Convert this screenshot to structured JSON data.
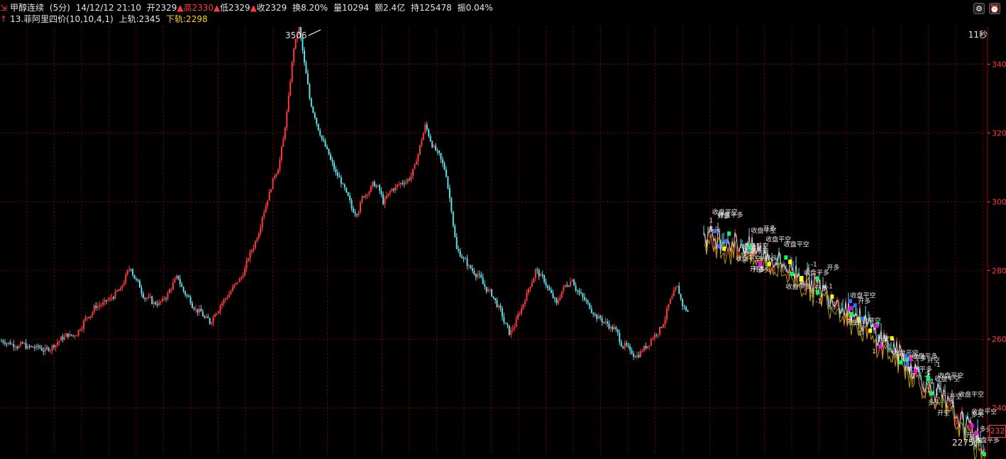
{
  "header": {
    "symbol_label": "甲醇连续",
    "period_label": "(5分)",
    "datetime": "14/12/12 21:10",
    "open": "开2329",
    "high": "高2330",
    "low": "低2329",
    "close": "收2329",
    "turnover": "换8.20%",
    "volume": "量10294",
    "amount": "额2.4亿",
    "position": "持125478",
    "amplitude": "振0.04%",
    "indicator_name": "13.菲阿里四价(10,10,4,1)",
    "upper_rail": "上轨:2345",
    "lower_rail": "下轨:2298",
    "colors": {
      "up": "#ff3b3b",
      "down": "#5fdfe8",
      "grid": "#7a0000",
      "text": "#e6e6e6",
      "yellow": "#ffd400"
    },
    "icons": [
      "gear-icon",
      "alarm-icon"
    ]
  },
  "countdown_label": "11秒",
  "current_price_label": "232",
  "chart_data": {
    "type": "candlestick",
    "y_axis": {
      "ticks": [
        "340",
        "320",
        "300",
        "280",
        "260",
        "240"
      ],
      "range": [
        2260,
        3500
      ]
    },
    "annotations": [
      {
        "label": "3506",
        "kind": "max"
      },
      {
        "label": "2275",
        "kind": "min"
      }
    ],
    "signals": [
      "-1",
      "1",
      "收盘平多",
      "收盘平空",
      "多头",
      "开空",
      "开多"
    ],
    "series_close": [
      2595,
      2590,
      2585,
      2582,
      2580,
      2576,
      2574,
      2572,
      2570,
      2578,
      2592,
      2605,
      2615,
      2610,
      2625,
      2650,
      2670,
      2690,
      2700,
      2705,
      2715,
      2730,
      2740,
      2780,
      2810,
      2770,
      2740,
      2720,
      2710,
      2705,
      2710,
      2730,
      2760,
      2780,
      2740,
      2720,
      2695,
      2680,
      2660,
      2650,
      2680,
      2700,
      2720,
      2740,
      2760,
      2780,
      2820,
      2860,
      2900,
      2960,
      3010,
      3060,
      3100,
      3180,
      3300,
      3450,
      3506,
      3400,
      3300,
      3250,
      3200,
      3160,
      3120,
      3080,
      3060,
      3020,
      2980,
      2970,
      3010,
      3030,
      3050,
      3040,
      3000,
      3020,
      3040,
      3050,
      3060,
      3070,
      3100,
      3160,
      3220,
      3180,
      3150,
      3120,
      3080,
      2980,
      2860,
      2840,
      2820,
      2800,
      2790,
      2760,
      2740,
      2720,
      2690,
      2650,
      2620,
      2640,
      2680,
      2720,
      2760,
      2800,
      2780,
      2760,
      2730,
      2700,
      2740,
      2760,
      2780,
      2740,
      2720,
      2700,
      2680,
      2660,
      2650,
      2640,
      2630,
      2600,
      2580,
      2560,
      2555,
      2560,
      2580,
      2600,
      2620,
      2640,
      2680,
      2720,
      2750,
      2700,
      2680
    ]
  }
}
